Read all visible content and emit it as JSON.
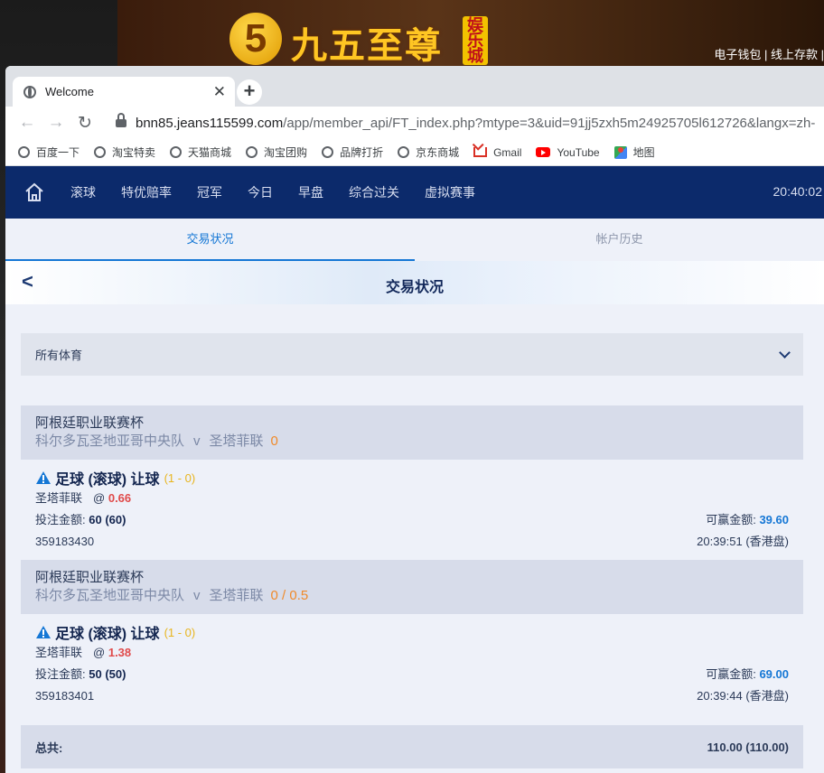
{
  "background": {
    "logo_text": "九五至尊",
    "logo_badge": "娱乐城",
    "top_links": "电子钱包 | 线上存款 |"
  },
  "browser": {
    "tab_title": "Welcome",
    "url_host": "bnn85.jeans115599.com",
    "url_path": "/app/member_api/FT_index.php?mtype=3&uid=91jj5zxh5m24925705l612726&langx=zh-",
    "bookmarks": [
      "百度一下",
      "淘宝特卖",
      "天猫商城",
      "淘宝团购",
      "品牌打折",
      "京东商城",
      "Gmail",
      "YouTube",
      "地图"
    ]
  },
  "nav": {
    "items": [
      "滚球",
      "特优赔率",
      "冠军",
      "今日",
      "早盘",
      "综合过关",
      "虚拟赛事"
    ],
    "time": "20:40:02"
  },
  "subtabs": [
    "交易状况",
    "帐户历史"
  ],
  "page_title": "交易状况",
  "filter": "所有体育",
  "bets": [
    {
      "league": "阿根廷职业联赛杯",
      "home": "科尔多瓦圣地亚哥中央队",
      "vs": "v",
      "away": "圣塔菲联",
      "handicap": "0",
      "market": "足球 (滚球) 让球",
      "score": "(1 - 0)",
      "pick": "圣塔菲联",
      "at": "@",
      "odds": "0.66",
      "stake_label": "投注金额:",
      "stake": "60 (60)",
      "win_label": "可赢金额:",
      "win": "39.60",
      "ticket": "359183430",
      "time": "20:39:51 (香港盘)"
    },
    {
      "league": "阿根廷职业联赛杯",
      "home": "科尔多瓦圣地亚哥中央队",
      "vs": "v",
      "away": "圣塔菲联",
      "handicap": "0 / 0.5",
      "market": "足球 (滚球) 让球",
      "score": "(1 - 0)",
      "pick": "圣塔菲联",
      "at": "@",
      "odds": "1.38",
      "stake_label": "投注金额:",
      "stake": "50 (50)",
      "win_label": "可赢金额:",
      "win": "69.00",
      "ticket": "359183401",
      "time": "20:39:44 (香港盘)"
    }
  ],
  "total": {
    "label": "总共:",
    "value": "110.00 (110.00)"
  }
}
